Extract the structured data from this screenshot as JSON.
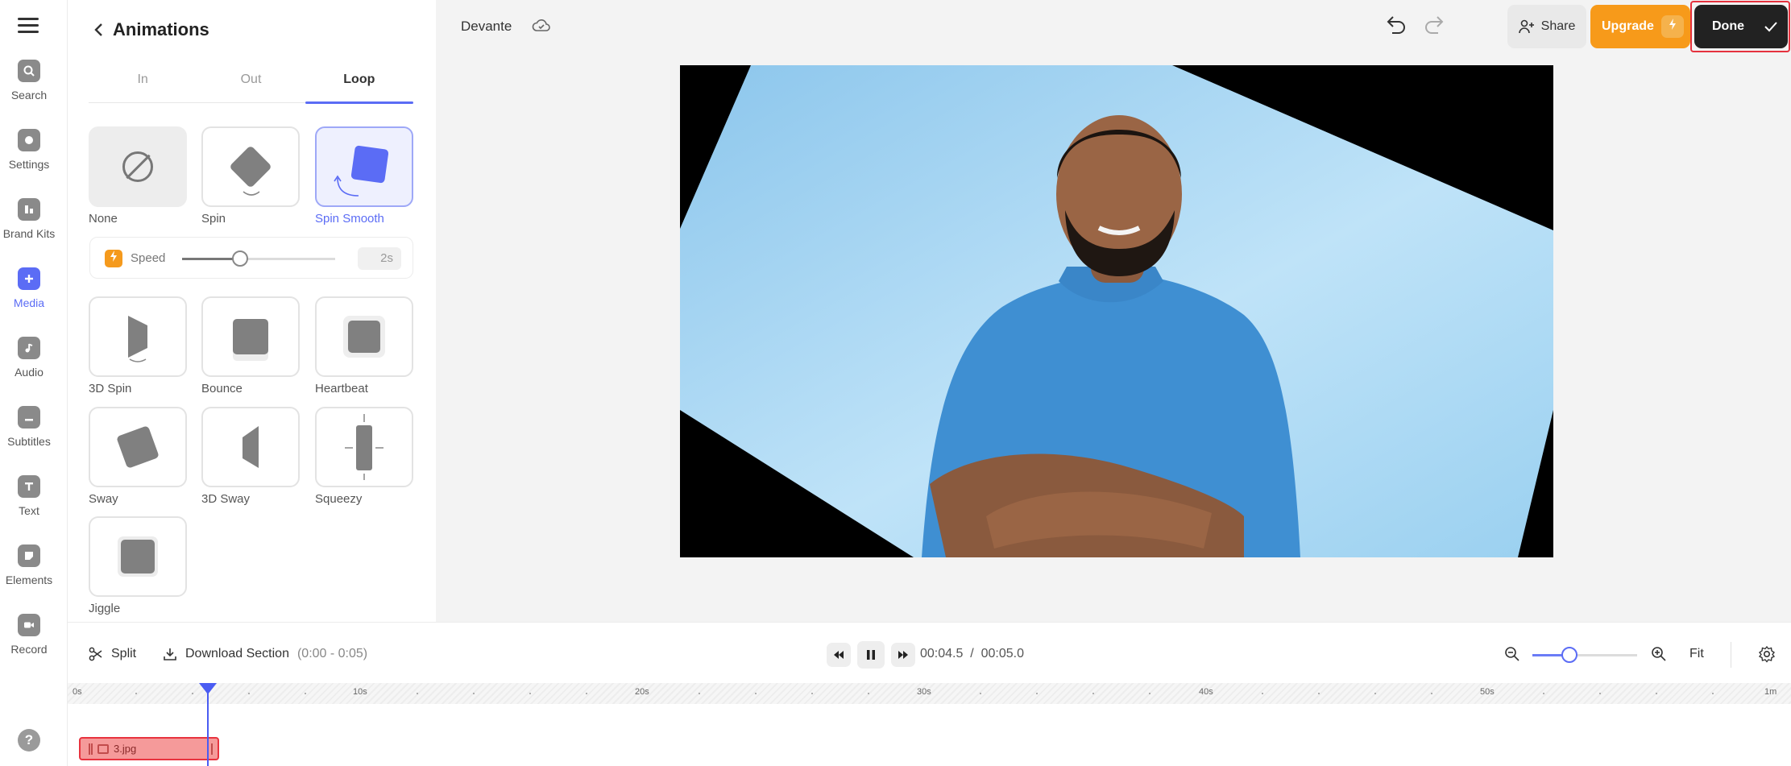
{
  "rail": {
    "items": [
      {
        "label": "Search",
        "icon": "search-icon"
      },
      {
        "label": "Settings",
        "icon": "settings-icon"
      },
      {
        "label": "Brand Kits",
        "icon": "brand-kits-icon"
      },
      {
        "label": "Media",
        "icon": "media-icon",
        "active": true
      },
      {
        "label": "Audio",
        "icon": "audio-icon"
      },
      {
        "label": "Subtitles",
        "icon": "subtitles-icon"
      },
      {
        "label": "Text",
        "icon": "text-icon"
      },
      {
        "label": "Elements",
        "icon": "elements-icon"
      },
      {
        "label": "Record",
        "icon": "record-icon"
      }
    ],
    "help_glyph": "?"
  },
  "panel": {
    "title": "Animations",
    "tabs": [
      {
        "label": "In"
      },
      {
        "label": "Out"
      },
      {
        "label": "Loop",
        "active": true
      }
    ],
    "animations": [
      {
        "label": "None"
      },
      {
        "label": "Spin"
      },
      {
        "label": "Spin Smooth",
        "selected": true
      },
      {
        "label": "3D Spin"
      },
      {
        "label": "Bounce"
      },
      {
        "label": "Heartbeat"
      },
      {
        "label": "Sway"
      },
      {
        "label": "3D Sway"
      },
      {
        "label": "Squeezy"
      },
      {
        "label": "Jiggle"
      }
    ],
    "speed": {
      "label": "Speed",
      "value": "2s",
      "level": 0.38
    }
  },
  "topbar": {
    "project_name": "Devante",
    "share_label": "Share",
    "upgrade_label": "Upgrade",
    "done_label": "Done"
  },
  "timeline": {
    "split_label": "Split",
    "download_label": "Download Section",
    "download_range": "(0:00 - 0:05)",
    "current_time": "00:04.5",
    "separator": "/",
    "total_time": "00:05.0",
    "fit_label": "Fit",
    "zoom_level": 0.35,
    "ruler_labels": [
      "0s",
      "10s",
      "20s",
      "30s",
      "40s",
      "50s",
      "1m"
    ],
    "clip_name": "3.jpg"
  },
  "colors": {
    "accent": "#5b6cf5",
    "upgrade": "#f79a1a",
    "done": "#222222",
    "highlight": "#e5323e",
    "photo_background": "#9fd4f2"
  }
}
